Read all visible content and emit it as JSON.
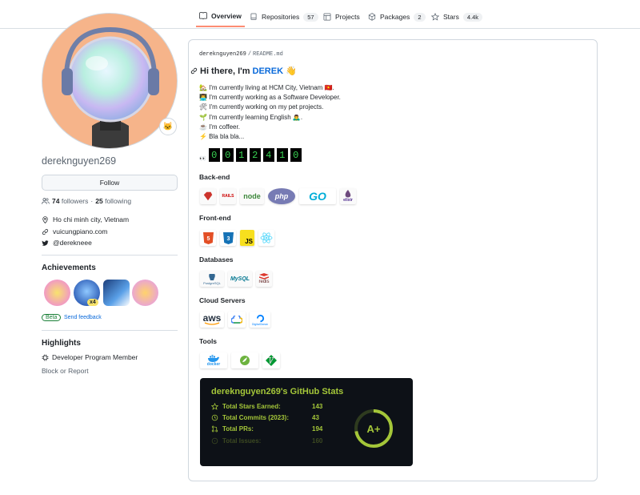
{
  "nav": {
    "tabs": [
      {
        "label": "Overview",
        "icon": "book-icon"
      },
      {
        "label": "Repositories",
        "count": "57",
        "icon": "repo-icon"
      },
      {
        "label": "Projects",
        "icon": "table-icon"
      },
      {
        "label": "Packages",
        "count": "2",
        "icon": "package-icon"
      },
      {
        "label": "Stars",
        "count": "4.4k",
        "icon": "star-icon"
      }
    ]
  },
  "profile": {
    "username": "dereknguyen269",
    "follow_label": "Follow",
    "followers_count": "74",
    "followers_label": "followers",
    "separator": "·",
    "following_count": "25",
    "following_label": "following",
    "location": "Ho chi minh city, Vietnam",
    "website": "vuicungpiano.com",
    "twitter": "@derekneee",
    "status_emoji": "🐱"
  },
  "achievements": {
    "title": "Achievements",
    "badge_multiplier": "x4",
    "beta_label": "Beta",
    "feedback_label": "Send feedback"
  },
  "highlights": {
    "title": "Highlights",
    "item": "Developer Program Member",
    "block_label": "Block or Report"
  },
  "readme": {
    "owner": "dereknguyen269",
    "slash": "/",
    "file": "README.md",
    "greeting_prefix": "Hi there, I'm",
    "greeting_name": "DEREK",
    "greeting_emoji": "👋",
    "bullets": [
      "🏡 I'm currently living at HCM City, Vietnam 🇻🇳.",
      "👨‍💻 I'm currently working as a Software Developer.",
      "🛠 I'm currently working on my pet projects.",
      "🌱 I'm currently learning English 🙇‍♂️.",
      "☕ I'm coffeer.",
      "⚡ Bla bla bla..."
    ],
    "visitor_icon": "👀",
    "visitor_digits": [
      "0",
      "0",
      "1",
      "2",
      "4",
      "1",
      "0"
    ],
    "sections": {
      "backend": "Back-end",
      "frontend": "Front-end",
      "databases": "Databases",
      "cloud": "Cloud Servers",
      "tools": "Tools"
    },
    "backend_logos": {
      "rails": "RAILS",
      "node": "node",
      "php": "php",
      "go": "GO",
      "elixir": "elixir"
    },
    "frontend_logos": {
      "js": "JS"
    },
    "database_logos": {
      "postgres": "PostgreSQL",
      "mysql": "MySQL",
      "redis": "redis"
    },
    "cloud_logos": {
      "aws": "aws",
      "do": "DigitalOcean"
    },
    "tool_logos": {
      "docker": "docker"
    }
  },
  "stats": {
    "title": "dereknguyen269's GitHub Stats",
    "rows": [
      {
        "label": "Total Stars Earned:",
        "value": "143"
      },
      {
        "label": "Total Commits (2023):",
        "value": "43"
      },
      {
        "label": "Total PRs:",
        "value": "194"
      },
      {
        "label": "Total Issues:",
        "value": "160"
      }
    ],
    "grade": "A+"
  },
  "colors": {
    "accent_tab": "#fd8c73",
    "link": "#0969da",
    "stats_bg": "#0d1117",
    "stats_fg": "#a4c639",
    "counter_fg": "#39d353"
  }
}
